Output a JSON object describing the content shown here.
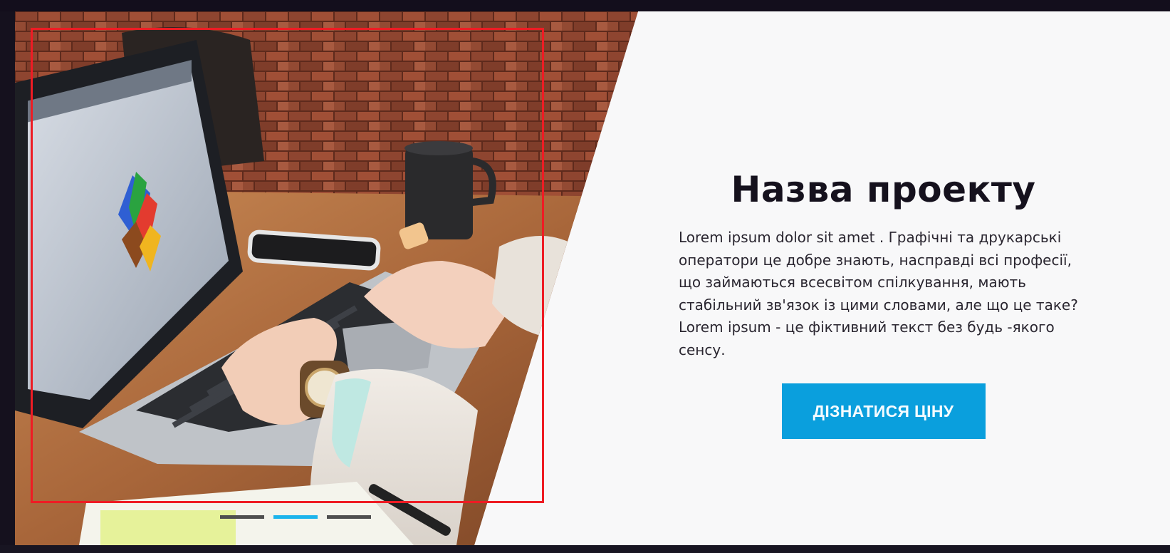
{
  "slide": {
    "photo_alt": "laptop-photo",
    "title": "Назва проекту",
    "description": "Lorem ipsum dolor sit amet . Графічні та друкарські\nоператори це добре знають, насправді всі професії,\nщо займаються всесвітом спілкування, мають\nстабільний зв'язок із цими словами, але що це таке?\nLorem ipsum - це фіктивний текст без будь -якого\nсенсу.",
    "cta_label": "ДІЗНАТИСЯ ЦІНУ"
  },
  "carousel": {
    "slide_count": 3,
    "active_index": 1
  },
  "colors": {
    "accent": "#0a9fdd",
    "active_dot": "#1cb4ec",
    "inactive_dot": "#4f4f4f",
    "frame": "#ee1c24",
    "background": "#f8f8f9",
    "dark_bar": "#130e1c"
  }
}
